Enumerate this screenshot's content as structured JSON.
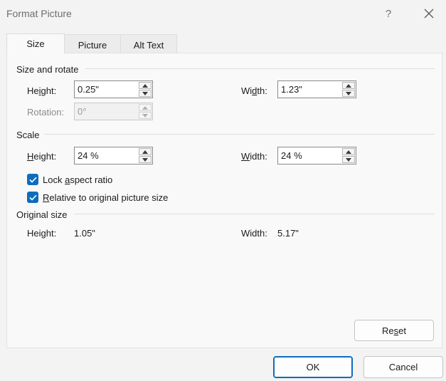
{
  "window": {
    "title": "Format Picture",
    "help_glyph": "?",
    "accent_color": "#0f6cbd"
  },
  "tabs": [
    {
      "label": "Size",
      "active": true
    },
    {
      "label": "Picture",
      "active": false
    },
    {
      "label": "Alt Text",
      "active": false
    }
  ],
  "size_and_rotate": {
    "heading": "Size and rotate",
    "height_label_pre": "He",
    "height_label_key": "i",
    "height_label_post": "ght:",
    "height_value": "0.25\"",
    "width_label_pre": "Wi",
    "width_label_key": "d",
    "width_label_post": "th:",
    "width_value": "1.23\"",
    "rotation_label": "Rotation:",
    "rotation_value": "0°",
    "rotation_disabled": true
  },
  "scale": {
    "heading": "Scale",
    "height_label_pre": "",
    "height_label_key": "H",
    "height_label_post": "eight:",
    "height_value": "24 %",
    "width_label_pre": "",
    "width_label_key": "W",
    "width_label_post": "idth:",
    "width_value": "24 %",
    "lock_aspect": {
      "label_pre": "Lock ",
      "label_key": "a",
      "label_post": "spect ratio",
      "checked": true
    },
    "relative_original": {
      "label_pre": "",
      "label_key": "R",
      "label_post": "elative to original picture size",
      "checked": true
    }
  },
  "original_size": {
    "heading": "Original size",
    "height_label": "Height:",
    "height_value": "1.05\"",
    "width_label": "Width:",
    "width_value": "5.17\""
  },
  "buttons": {
    "reset_pre": "Re",
    "reset_key": "s",
    "reset_post": "et",
    "ok": "OK",
    "cancel": "Cancel"
  }
}
